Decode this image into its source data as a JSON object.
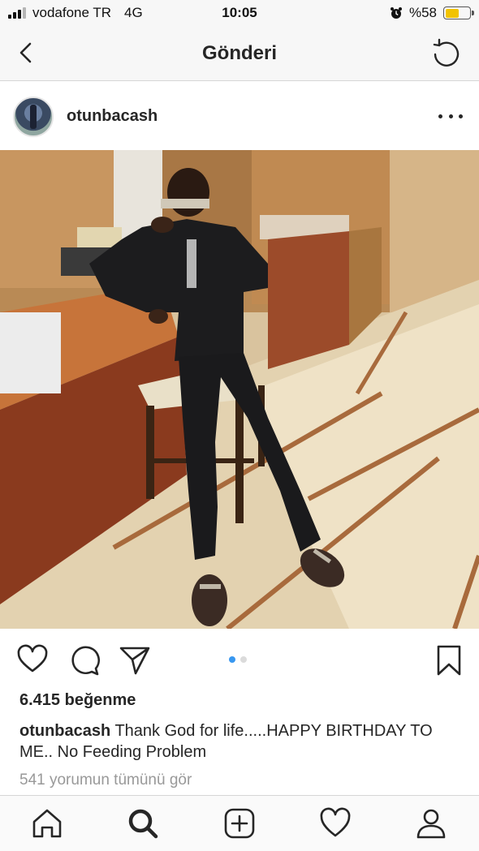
{
  "status_bar": {
    "carrier": "vodafone TR",
    "network": "4G",
    "time": "10:05",
    "battery_percent": "%58",
    "battery_level": 0.58
  },
  "nav": {
    "title": "Gönderi",
    "back_icon": "chevron-left-icon",
    "refresh_icon": "refresh-icon"
  },
  "post": {
    "username": "otunbacash",
    "more_icon": "more-horizontal-icon",
    "carousel": {
      "count": 2,
      "active_index": 0
    },
    "likes": "6.415 beğenme",
    "caption": {
      "user": "otunbacash",
      "text": "Thank God for life.....HAPPY BIRTHDAY TO ME.. No Feeding Problem"
    },
    "comments_link": "541 yorumun tümünü gör"
  },
  "actions": {
    "like_icon": "heart-icon",
    "comment_icon": "comment-icon",
    "share_icon": "send-icon",
    "save_icon": "bookmark-icon"
  },
  "tab_bar": {
    "items": [
      "home-icon",
      "search-icon",
      "add-icon",
      "activity-heart-icon",
      "profile-icon"
    ],
    "active": "search-icon"
  },
  "colors": {
    "accent": "#3897f0",
    "text": "#262626",
    "secondary_text": "#999999",
    "battery": "#f2c300"
  }
}
